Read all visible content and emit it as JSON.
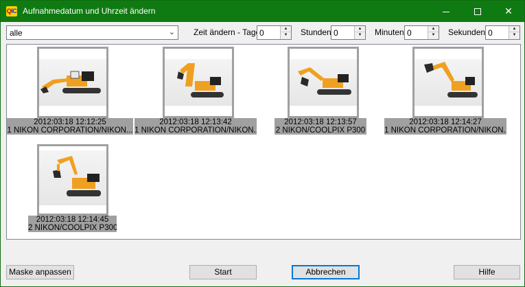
{
  "window": {
    "title": "Aufnahmedatum und Uhrzeit ändern",
    "icon_text_a": "Q",
    "icon_text_b": "IC"
  },
  "toolbar": {
    "filter_value": "alle",
    "days_label": "Zeit ändern - Tage",
    "days_value": "0",
    "hours_label": "Stunden",
    "hours_value": "0",
    "minutes_label": "Minuten",
    "minutes_value": "0",
    "seconds_label": "Sekunden",
    "seconds_value": "0"
  },
  "images": [
    {
      "datetime": "2012:03:18 12:12:25",
      "camera": "1 NIKON CORPORATION/NIKON..."
    },
    {
      "datetime": "2012:03:18 12:13:42",
      "camera": "1 NIKON CORPORATION/NIKON..."
    },
    {
      "datetime": "2012:03:18 12:13:57",
      "camera": "2 NIKON/COOLPIX P300"
    },
    {
      "datetime": "2012:03:18 12:14:27",
      "camera": "1 NIKON CORPORATION/NIKON..."
    },
    {
      "datetime": "2012:03:18 12:14:45",
      "camera": "2 NIKON/COOLPIX P300"
    }
  ],
  "buttons": {
    "mask": "Maske anpassen",
    "start": "Start",
    "cancel": "Abbrechen",
    "help": "Hilfe"
  },
  "colors": {
    "titlebar": "#0f7a12",
    "excavator_body": "#f0a020",
    "caption_bg": "#a0a0a0"
  }
}
